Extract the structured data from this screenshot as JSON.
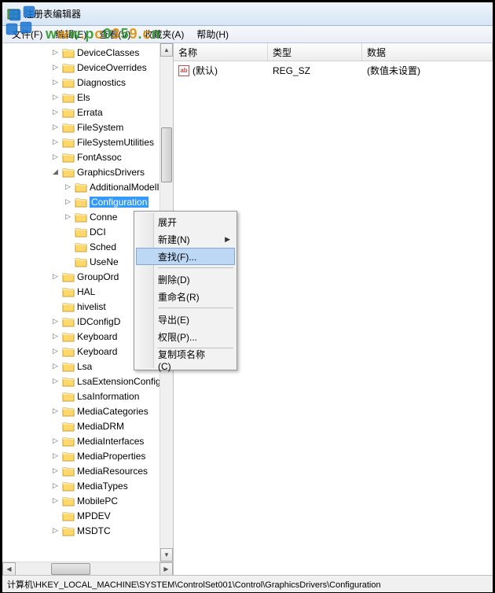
{
  "window": {
    "title": "注册表编辑器"
  },
  "watermark": "www.pc0359.cn",
  "menu": {
    "file": "文件(F)",
    "edit": "编辑(E)",
    "view": "查看(V)",
    "favorites": "收藏夹(A)",
    "help": "帮助(H)"
  },
  "tree": [
    {
      "label": "DeviceClasses",
      "level": 3,
      "exp": "▷"
    },
    {
      "label": "DeviceOverrides",
      "level": 3,
      "exp": "▷"
    },
    {
      "label": "Diagnostics",
      "level": 3,
      "exp": "▷"
    },
    {
      "label": "Els",
      "level": 3,
      "exp": "▷"
    },
    {
      "label": "Errata",
      "level": 3,
      "exp": "▷"
    },
    {
      "label": "FileSystem",
      "level": 3,
      "exp": "▷"
    },
    {
      "label": "FileSystemUtilities",
      "level": 3,
      "exp": "▷"
    },
    {
      "label": "FontAssoc",
      "level": 3,
      "exp": "▷"
    },
    {
      "label": "GraphicsDrivers",
      "level": 3,
      "exp": "◢"
    },
    {
      "label": "AdditionalModelI",
      "level": 4,
      "exp": "▷"
    },
    {
      "label": "Configuration",
      "level": 4,
      "exp": "▷",
      "selected": true
    },
    {
      "label": "Conne",
      "level": 4,
      "exp": "▷"
    },
    {
      "label": "DCI",
      "level": 4,
      "exp": ""
    },
    {
      "label": "Sched",
      "level": 4,
      "exp": ""
    },
    {
      "label": "UseNe",
      "level": 4,
      "exp": ""
    },
    {
      "label": "GroupOrd",
      "level": 3,
      "exp": "▷"
    },
    {
      "label": "HAL",
      "level": 3,
      "exp": ""
    },
    {
      "label": "hivelist",
      "level": 3,
      "exp": ""
    },
    {
      "label": "IDConfigD",
      "level": 3,
      "exp": "▷"
    },
    {
      "label": "Keyboard",
      "level": 3,
      "exp": "▷"
    },
    {
      "label": "Keyboard",
      "level": 3,
      "exp": "▷"
    },
    {
      "label": "Lsa",
      "level": 3,
      "exp": "▷"
    },
    {
      "label": "LsaExtensionConfig",
      "level": 3,
      "exp": "▷"
    },
    {
      "label": "LsaInformation",
      "level": 3,
      "exp": ""
    },
    {
      "label": "MediaCategories",
      "level": 3,
      "exp": "▷"
    },
    {
      "label": "MediaDRM",
      "level": 3,
      "exp": ""
    },
    {
      "label": "MediaInterfaces",
      "level": 3,
      "exp": "▷"
    },
    {
      "label": "MediaProperties",
      "level": 3,
      "exp": "▷"
    },
    {
      "label": "MediaResources",
      "level": 3,
      "exp": "▷"
    },
    {
      "label": "MediaTypes",
      "level": 3,
      "exp": "▷"
    },
    {
      "label": "MobilePC",
      "level": 3,
      "exp": "▷"
    },
    {
      "label": "MPDEV",
      "level": 3,
      "exp": ""
    },
    {
      "label": "MSDTC",
      "level": 3,
      "exp": "▷"
    }
  ],
  "list": {
    "columns": {
      "name": "名称",
      "type": "类型",
      "data": "数据"
    },
    "widths": {
      "name": 120,
      "type": 120,
      "data": 150
    },
    "rows": [
      {
        "name": "(默认)",
        "type": "REG_SZ",
        "data": "(数值未设置)"
      }
    ]
  },
  "contextMenu": {
    "expand": "展开",
    "new": "新建(N)",
    "find": "查找(F)...",
    "delete": "删除(D)",
    "rename": "重命名(R)",
    "export": "导出(E)",
    "permissions": "权限(P)...",
    "copyKeyName": "复制项名称(C)"
  },
  "status": "计算机\\HKEY_LOCAL_MACHINE\\SYSTEM\\ControlSet001\\Control\\GraphicsDrivers\\Configuration"
}
